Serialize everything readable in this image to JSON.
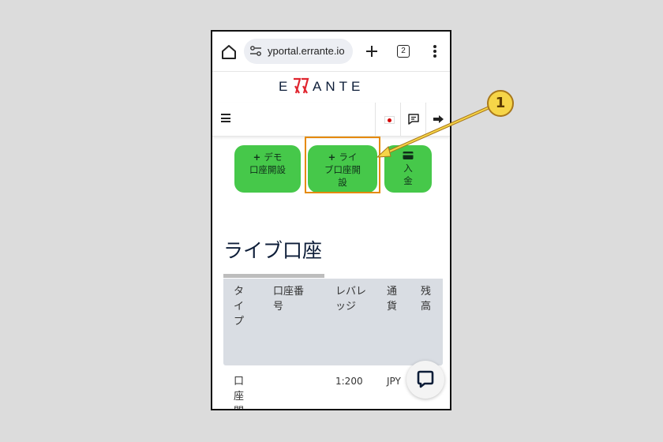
{
  "browser": {
    "url": "yportal.errante.io",
    "tab_count": "2"
  },
  "brand": {
    "logo_text": "ERRANTE"
  },
  "header": {
    "menu_icon": "hamburger-icon",
    "language_icon": "japan-flag-icon",
    "chat_icon": "message-icon",
    "logout_icon": "logout-icon"
  },
  "actions": [
    {
      "icon": "+",
      "line1": "デモ",
      "line2": "口座開設",
      "line3": ""
    },
    {
      "icon": "+",
      "line1": "ライ",
      "line2": "ブ口座開",
      "line3": "設"
    },
    {
      "icon": "card-icon",
      "line1": "入",
      "line2": "金",
      "line3": ""
    }
  ],
  "section": {
    "title": "ライブ口座"
  },
  "table": {
    "headers": [
      "タ\nイ\nプ",
      "口座番\n号",
      "レバレ\nッジ",
      "通\n貨",
      "残\n高"
    ],
    "row": {
      "type": "口\n座\n開",
      "leverage": "1:200",
      "currency": "JPY"
    }
  },
  "annotation": {
    "callout_number": "1"
  },
  "colors": {
    "accent_green": "#46c84a",
    "highlight": "#e58a00",
    "brand_red": "#e0252f",
    "navy": "#0d1d38"
  }
}
